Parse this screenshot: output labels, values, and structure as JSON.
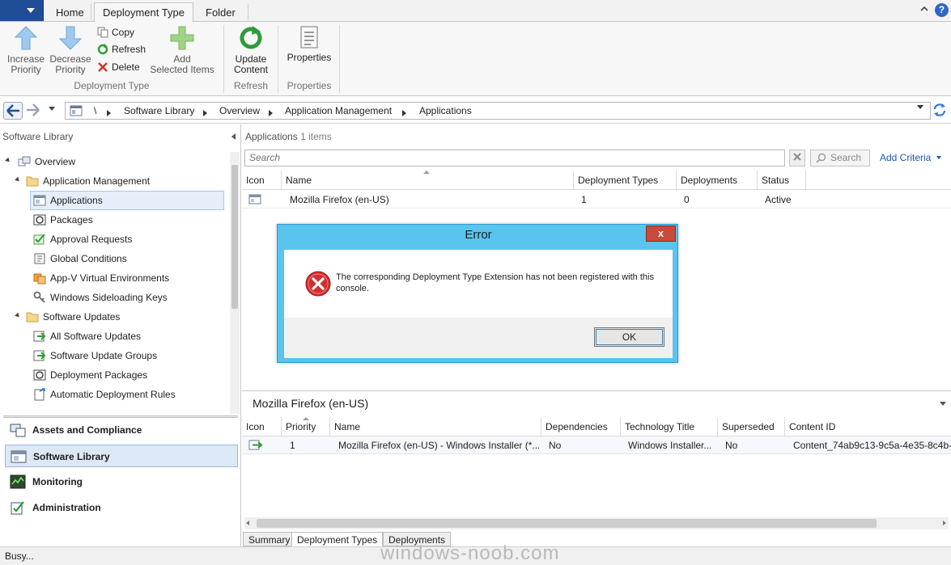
{
  "ribbon": {
    "tabs": [
      {
        "label": "Home"
      },
      {
        "label": "Deployment Type"
      },
      {
        "label": "Folder"
      }
    ],
    "buttons": {
      "increase_priority": "Increase\nPriority",
      "decrease_priority": "Decrease\nPriority",
      "copy": "Copy",
      "refresh": "Refresh",
      "delete": "Delete",
      "add_selected_items": "Add\nSelected Items",
      "update_content": "Update\nContent",
      "properties": "Properties"
    },
    "groups": {
      "deployment_type": "Deployment Type",
      "refresh": "Refresh",
      "properties": "Properties"
    }
  },
  "breadcrumb": [
    "\\",
    "Software Library",
    "Overview",
    "Application Management",
    "Applications"
  ],
  "left_pane": {
    "title": "Software Library",
    "tree": [
      {
        "label": "Overview",
        "icon": "overview-icon"
      },
      {
        "label": "Application Management",
        "icon": "folder-icon"
      },
      {
        "label": "Applications",
        "icon": "application-icon",
        "selected": true
      },
      {
        "label": "Packages",
        "icon": "package-icon"
      },
      {
        "label": "Approval Requests",
        "icon": "approval-icon"
      },
      {
        "label": "Global Conditions",
        "icon": "global-conditions-icon"
      },
      {
        "label": "App-V Virtual Environments",
        "icon": "appv-icon"
      },
      {
        "label": "Windows Sideloading Keys",
        "icon": "key-icon"
      },
      {
        "label": "Software Updates",
        "icon": "folder-icon"
      },
      {
        "label": "All Software Updates",
        "icon": "update-icon"
      },
      {
        "label": "Software Update Groups",
        "icon": "update-group-icon"
      },
      {
        "label": "Deployment Packages",
        "icon": "package-icon"
      },
      {
        "label": "Automatic Deployment Rules",
        "icon": "rule-icon"
      }
    ],
    "workspaces": [
      {
        "label": "Assets and Compliance"
      },
      {
        "label": "Software Library",
        "selected": true
      },
      {
        "label": "Monitoring"
      },
      {
        "label": "Administration"
      }
    ]
  },
  "main": {
    "title": "Applications",
    "count": "1 items",
    "search_placeholder": "Search",
    "search_button": "Search",
    "add_criteria": "Add Criteria",
    "columns": [
      "Icon",
      "Name",
      "Deployment Types",
      "Deployments",
      "Status"
    ],
    "rows": [
      {
        "name": "Mozilla Firefox (en-US)",
        "deployment_types": "1",
        "deployments": "0",
        "status": "Active"
      }
    ]
  },
  "details": {
    "title": "Mozilla Firefox (en-US)",
    "columns": [
      "Icon",
      "Priority",
      "Name",
      "Dependencies",
      "Technology Title",
      "Superseded",
      "Content ID"
    ],
    "rows": [
      {
        "priority": "1",
        "name": "Mozilla Firefox (en-US) - Windows Installer (*...",
        "dependencies": "No",
        "technology_title": "Windows Installer...",
        "superseded": "No",
        "content_id": "Content_74ab9c13-9c5a-4e35-8c4b-"
      }
    ],
    "tabs": [
      {
        "label": "Summary"
      },
      {
        "label": "Deployment Types"
      },
      {
        "label": "Deployments"
      }
    ]
  },
  "status": "Busy...",
  "watermark": "windows-noob.com",
  "dialog": {
    "title": "Error",
    "close": "x",
    "message": "The corresponding Deployment Type Extension has not been registered with this console.",
    "ok": "OK"
  }
}
